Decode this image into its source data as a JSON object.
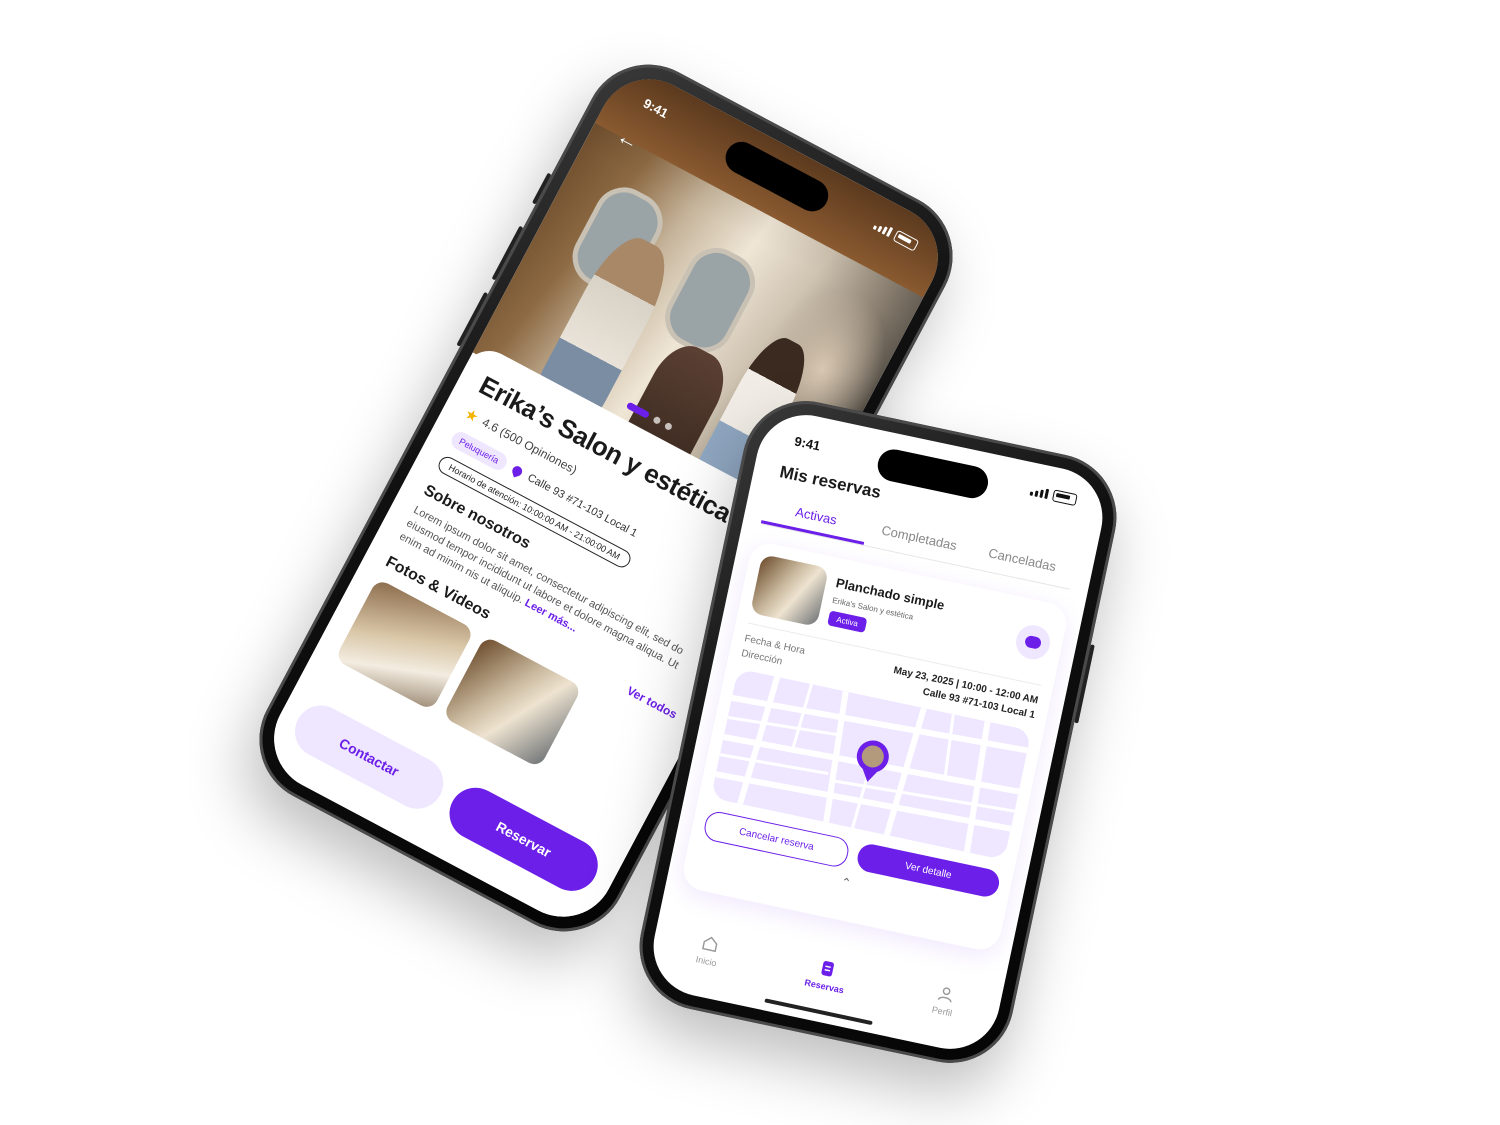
{
  "phone1": {
    "status_time": "9:41",
    "salon_name": "Erika’s Salon y estética",
    "rating": "4.6 (500 Opiniones)",
    "category": "Peluquería",
    "address": "Calle 93 #71-103 Local 1",
    "hours": "Horario de atención: 10:00:00 AM - 21:00:00 AM",
    "about_heading": "Sobre nosotros",
    "about_text": "Lorem ipsum dolor sit amet, consectetur adipiscing elit, sed do eiusmod tempor incididunt ut labore et dolore magna aliqua. Ut enim ad minim nis ut aliquip.",
    "read_more": "Leer más...",
    "photos_heading": "Fotos & Videos",
    "see_all": "Ver todos",
    "contact_button": "Contactar",
    "book_button": "Reservar"
  },
  "phone2": {
    "status_time": "9:41",
    "page_title": "Mis reservas",
    "tabs": [
      "Activas",
      "Completadas",
      "Canceladas"
    ],
    "service_name": "Planchado simple",
    "salon_name": "Erika's Salon y estética",
    "status_badge": "Activa",
    "date_label": "Fecha & Hora",
    "date_value": "May 23, 2025 | 10:00 - 12:00 AM",
    "address_label": "Dirección",
    "address_value": "Calle 93 #71-103 Local 1",
    "cancel_button": "Cancelar reserva",
    "detail_button": "Ver detalle",
    "nav": [
      "Inicio",
      "Reservas",
      "Perfil"
    ]
  },
  "colors": {
    "accent": "#6c1fe8",
    "accent_soft": "#efe6ff"
  }
}
